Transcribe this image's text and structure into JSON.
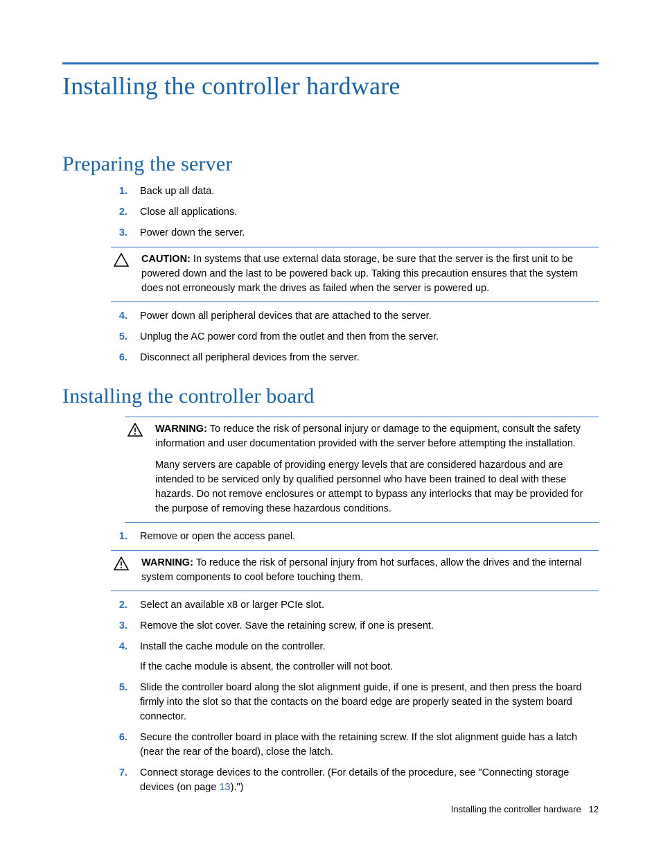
{
  "title": "Installing the controller hardware",
  "sections": {
    "prep": {
      "heading": "Preparing the server",
      "items": [
        "Back up all data.",
        "Close all applications.",
        "Power down the server.",
        "Power down all peripheral devices that are attached to the server.",
        "Unplug the AC power cord from the outlet and then from the server.",
        "Disconnect all peripheral devices from the server."
      ],
      "caution": {
        "label": "CAUTION:",
        "text": "In systems that use external data storage, be sure that the server is the first unit to be powered down and the last to be powered back up. Taking this precaution ensures that the system does not erroneously mark the drives as failed when the server is powered up."
      }
    },
    "install": {
      "heading": "Installing the controller board",
      "warning1": {
        "label": "WARNING:",
        "text": "To reduce the risk of personal injury or damage to the equipment, consult the safety information and user documentation provided with the server before attempting the installation.",
        "text2": "Many servers are capable of providing energy levels that are considered hazardous and are intended to be serviced only by qualified personnel who have been trained to deal with these hazards. Do not remove enclosures or attempt to bypass any interlocks that may be provided for the purpose of removing these hazardous conditions."
      },
      "items": {
        "i1": "Remove or open the access panel.",
        "i2": "Select an available x8 or larger PCIe slot.",
        "i3": "Remove the slot cover. Save the retaining screw, if one is present.",
        "i4": "Install the cache module on the controller.",
        "i4b": "If the cache module is absent, the controller will not boot.",
        "i5": "Slide the controller board along the slot alignment guide, if one is present, and then press the board firmly into the slot so that the contacts on the board edge are properly seated in the system board connector.",
        "i6": "Secure the controller board in place with the retaining screw. If the slot alignment guide has a latch (near the rear of the board), close the latch.",
        "i7a": "Connect storage devices to the controller. (For details of the procedure, see \"Connecting storage devices (on page ",
        "i7link": "13",
        "i7b": ").\")"
      },
      "warning2": {
        "label": "WARNING:",
        "text": "To reduce the risk of personal injury from hot surfaces, allow the drives and the internal system components to cool before touching them."
      }
    }
  },
  "footer": {
    "text": "Installing the controller hardware",
    "page": "12"
  }
}
